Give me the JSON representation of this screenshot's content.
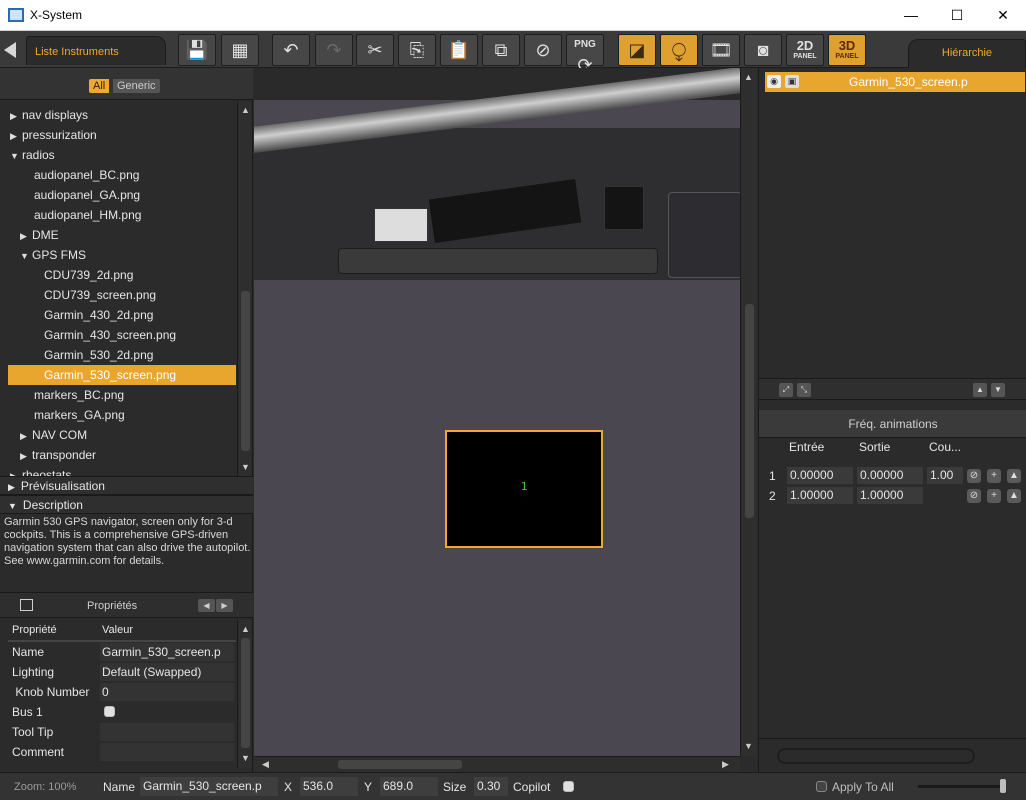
{
  "window": {
    "title": "X-System",
    "minimize_glyph": "—",
    "maximize_glyph": "☐",
    "close_glyph": "✕"
  },
  "toolbar": {
    "left_tab": "Liste Instruments",
    "right_tab": "Hiérarchie",
    "panel2d": "2D",
    "panel3d": "3D",
    "panel_word": "PANEL",
    "png_label": "PNG"
  },
  "filter": {
    "all": "All",
    "generic": "Generic"
  },
  "tree": [
    {
      "label": "nav displays",
      "level": 0,
      "arrow": "▶"
    },
    {
      "label": "pressurization",
      "level": 0,
      "arrow": "▶"
    },
    {
      "label": "radios",
      "level": 0,
      "arrow": "▼"
    },
    {
      "label": "audiopanel_BC.png",
      "level": 1,
      "arrow": ""
    },
    {
      "label": "audiopanel_GA.png",
      "level": 1,
      "arrow": ""
    },
    {
      "label": "audiopanel_HM.png",
      "level": 1,
      "arrow": ""
    },
    {
      "label": "DME",
      "level": 1,
      "arrow": "▶"
    },
    {
      "label": "GPS FMS",
      "level": 1,
      "arrow": "▼"
    },
    {
      "label": "CDU739_2d.png",
      "level": 2,
      "arrow": ""
    },
    {
      "label": "CDU739_screen.png",
      "level": 2,
      "arrow": ""
    },
    {
      "label": "Garmin_430_2d.png",
      "level": 2,
      "arrow": ""
    },
    {
      "label": "Garmin_430_screen.png",
      "level": 2,
      "arrow": ""
    },
    {
      "label": "Garmin_530_2d.png",
      "level": 2,
      "arrow": ""
    },
    {
      "label": "Garmin_530_screen.png",
      "level": 2,
      "arrow": "",
      "selected": true
    },
    {
      "label": "markers_BC.png",
      "level": 1,
      "arrow": ""
    },
    {
      "label": "markers_GA.png",
      "level": 1,
      "arrow": ""
    },
    {
      "label": "NAV COM",
      "level": 1,
      "arrow": "▶"
    },
    {
      "label": "transponder",
      "level": 1,
      "arrow": "▶"
    },
    {
      "label": "rheostats",
      "level": 0,
      "arrow": "▶"
    }
  ],
  "sections": {
    "preview": "Prévisualisation",
    "description": "Description",
    "description_text": "Garmin 530 GPS navigator, screen only for 3-d cockpits. This is a comprehensive GPS-driven navigation system that can also drive the autopilot. See www.garmin.com for details."
  },
  "properties": {
    "header": "Propriétés",
    "col_property": "Propriété",
    "col_value": "Valeur",
    "rows": [
      {
        "key": "Name",
        "value": "Garmin_530_screen.p"
      },
      {
        "key": "Lighting",
        "value": "Default (Swapped)"
      },
      {
        "key": " Knob Number",
        "value": "0"
      },
      {
        "key": "Bus 1",
        "value": ""
      },
      {
        "key": "Tool Tip",
        "value": ""
      },
      {
        "key": "Comment",
        "value": ""
      }
    ]
  },
  "viewport": {
    "screen_label": "1"
  },
  "hierarchy": {
    "selected_item": "Garmin_530_screen.p"
  },
  "animations": {
    "header": "Fréq. animations",
    "col_entree": "Entrée",
    "col_sortie": "Sortie",
    "col_cou": "Cou...",
    "rows": [
      {
        "idx": "1",
        "entree": "0.00000",
        "sortie": "0.00000",
        "cou": "1.00"
      },
      {
        "idx": "2",
        "entree": "1.00000",
        "sortie": "1.00000",
        "cou": ""
      }
    ]
  },
  "status": {
    "zoom": "Zoom: 100%",
    "name_label": "Name",
    "name_value": "Garmin_530_screen.p",
    "x_label": "X",
    "x_value": "536.0",
    "y_label": "Y",
    "y_value": "689.0",
    "size_label": "Size",
    "size_value": "0.30",
    "copilot_label": "Copilot",
    "apply_label": "Apply To All"
  },
  "colors": {
    "accent": "#e8a62e",
    "background": "#2b2b2b",
    "toolbar": "#3a3a3a"
  }
}
